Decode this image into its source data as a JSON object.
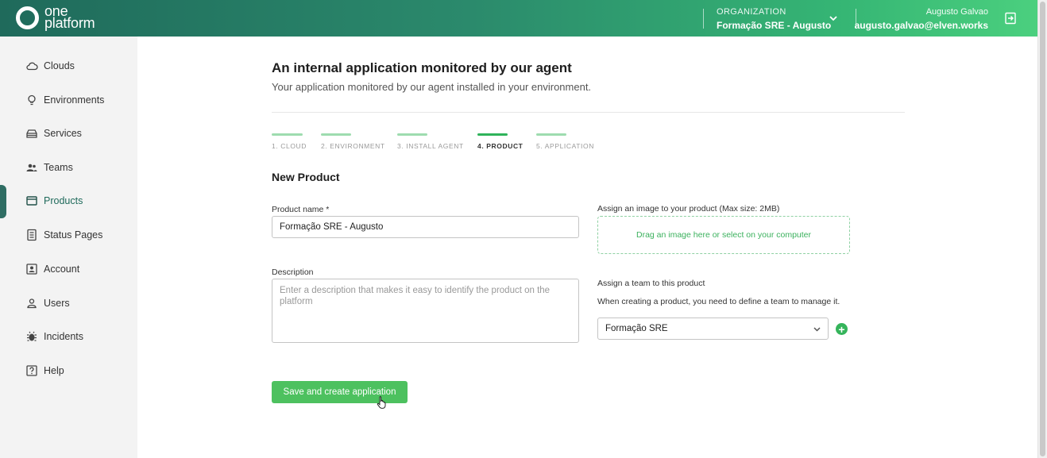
{
  "header": {
    "logo_line1": "one",
    "logo_line2": "platform",
    "org_label": "ORGANIZATION",
    "org_name": "Formação SRE - Augusto",
    "user_name": "Augusto Galvao",
    "user_email": "augusto.galvao@elven.works"
  },
  "sidebar": {
    "items": [
      {
        "label": "Clouds",
        "icon": "cloud-icon"
      },
      {
        "label": "Environments",
        "icon": "lightbulb-icon"
      },
      {
        "label": "Services",
        "icon": "services-icon"
      },
      {
        "label": "Teams",
        "icon": "teams-icon"
      },
      {
        "label": "Products",
        "icon": "products-icon"
      },
      {
        "label": "Status Pages",
        "icon": "status-pages-icon"
      },
      {
        "label": "Account",
        "icon": "account-icon"
      },
      {
        "label": "Users",
        "icon": "user-icon"
      },
      {
        "label": "Incidents",
        "icon": "bug-icon"
      },
      {
        "label": "Help",
        "icon": "help-icon"
      }
    ],
    "active": "Products"
  },
  "main": {
    "title": "An internal application monitored by our agent",
    "subtitle": "Your application monitored by our agent installed in your environment.",
    "steps": [
      "1. CLOUD",
      "2. ENVIRONMENT",
      "3. INSTALL AGENT",
      "4. PRODUCT",
      "5. APPLICATION"
    ],
    "active_step": "4. PRODUCT",
    "section_title": "New Product",
    "product_name_label": "Product name *",
    "product_name_value": "Formação SRE - Augusto",
    "description_label": "Description",
    "description_placeholder": "Enter a description that makes it easy to identify the product on the platform",
    "image_label": "Assign an image to your product (Max size: 2MB)",
    "dropzone_text": "Drag an image here or select on your computer",
    "team_label": "Assign a team to this product",
    "team_help": "When creating a product, you need to define a team to manage it.",
    "team_selected": "Formação SRE",
    "add_symbol": "+",
    "save_label": "Save and create application"
  },
  "colors": {
    "accent": "#4dc15f",
    "header_start": "#1f6a5b",
    "header_end": "#4cd17f",
    "active_nav": "#2f6d63"
  }
}
